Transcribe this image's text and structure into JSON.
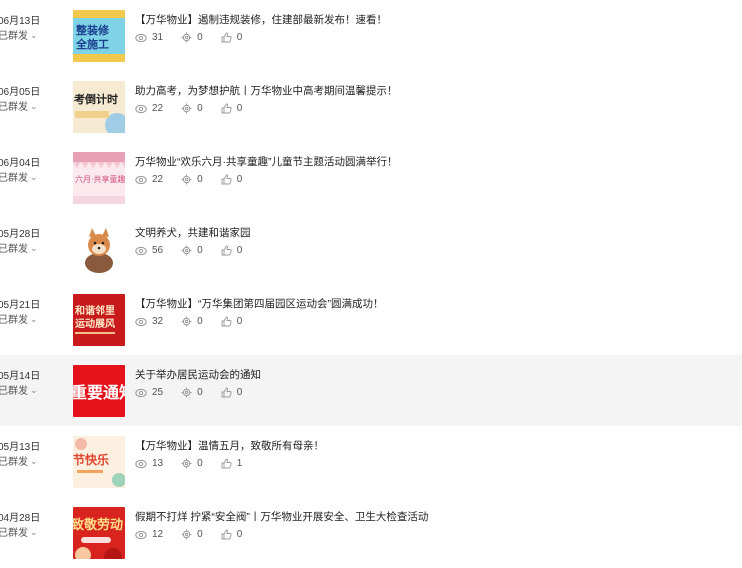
{
  "status_label": "已群发",
  "colors": {
    "red": "#d9231e",
    "orange": "#f0a136",
    "gray_text": "#555555"
  },
  "icons": {
    "views": "eye-icon",
    "shares": "share-gear-icon",
    "likes": "thumbs-up-icon"
  },
  "items": [
    {
      "date": "06月13日",
      "status": "已群发",
      "title": "【万华物业】遏制违规装修，住建部最新发布！速看！",
      "views": "31",
      "shares": "0",
      "likes": "0",
      "thumb_text": "整装修\n全施工"
    },
    {
      "date": "06月05日",
      "status": "已群发",
      "title": "助力高考，为梦想护航丨万华物业中高考期间温馨提示！",
      "views": "22",
      "shares": "0",
      "likes": "0",
      "thumb_text": "考倒计时"
    },
    {
      "date": "06月04日",
      "status": "已群发",
      "title": "万华物业“欢乐六月·共享童趣”儿童节主题活动圆满举行！",
      "views": "22",
      "shares": "0",
      "likes": "0",
      "thumb_text": "六月·共享童趣"
    },
    {
      "date": "05月28日",
      "status": "已群发",
      "title": "文明养犬，共建和谐家园",
      "views": "56",
      "shares": "0",
      "likes": "0",
      "thumb_text": ""
    },
    {
      "date": "05月21日",
      "status": "已群发",
      "title": "【万华物业】“万华集团第四届园区运动会”圆满成功！",
      "views": "32",
      "shares": "0",
      "likes": "0",
      "thumb_text": "和谐邻里\n运动展风"
    },
    {
      "date": "05月14日",
      "status": "已群发",
      "title": "关于举办居民运动会的通知",
      "views": "25",
      "shares": "0",
      "likes": "0",
      "thumb_text": "重要通知"
    },
    {
      "date": "05月13日",
      "status": "已群发",
      "title": "【万华物业】温情五月，致敬所有母亲！",
      "views": "13",
      "shares": "0",
      "likes": "1",
      "thumb_text": "节快乐"
    },
    {
      "date": "04月28日",
      "status": "已群发",
      "title": "假期不打烊 拧紧“安全阀”丨万华物业开展安全、卫生大检查活动",
      "views": "12",
      "shares": "0",
      "likes": "0",
      "thumb_text": "致敬劳动"
    }
  ]
}
